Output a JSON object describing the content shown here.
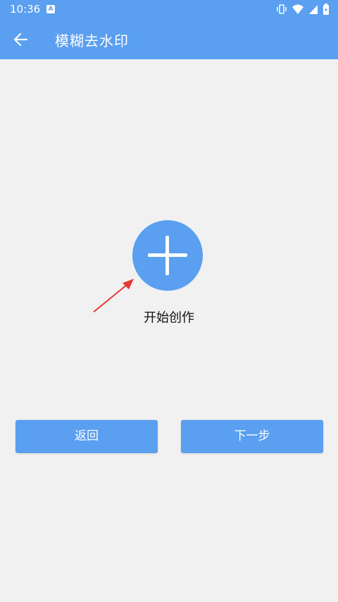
{
  "status_bar": {
    "time": "10:36",
    "badge": "A",
    "icons": [
      "vibrate-icon",
      "wifi-icon",
      "signal-icon",
      "battery-icon"
    ]
  },
  "app_bar": {
    "title": "模糊去水印",
    "back_icon": "arrow-left-icon",
    "color": "#5a9ff0"
  },
  "main": {
    "create_icon": "plus-icon",
    "create_label": "开始创作",
    "annotation": "red-arrow-icon"
  },
  "footer": {
    "back_label": "返回",
    "next_label": "下一步"
  }
}
